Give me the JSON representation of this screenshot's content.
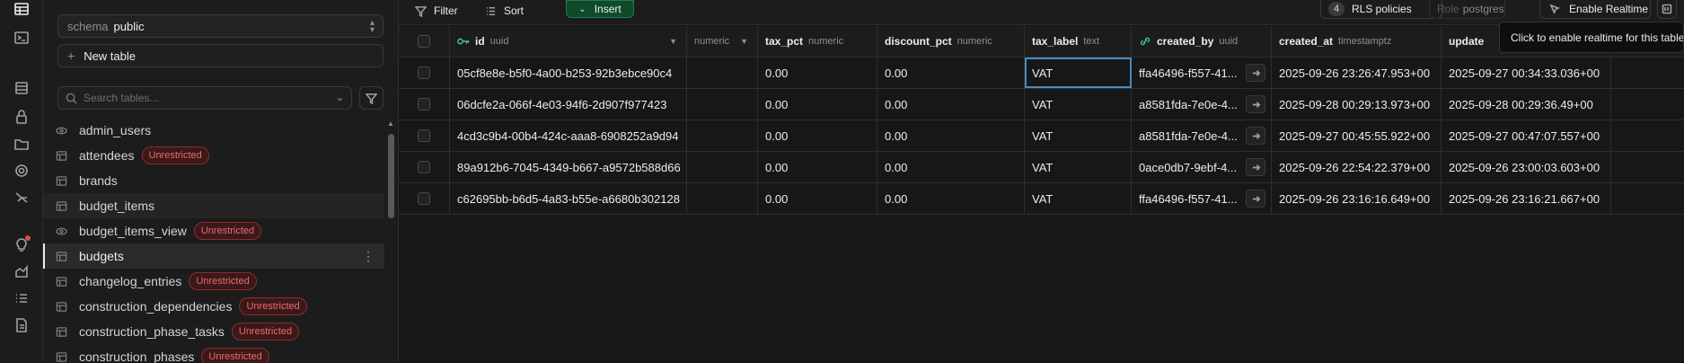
{
  "sidebar": {
    "schema_label": "schema",
    "schema_value": "public",
    "new_table_label": "New table",
    "search_placeholder": "Search tables...",
    "tables": [
      {
        "name": "admin_users",
        "badge": "",
        "icon": "view-icon"
      },
      {
        "name": "attendees",
        "badge": "Unrestricted",
        "icon": "table-icon"
      },
      {
        "name": "brands",
        "badge": "",
        "icon": "table-icon"
      },
      {
        "name": "budget_items",
        "badge": "",
        "icon": "table-icon"
      },
      {
        "name": "budget_items_view",
        "badge": "Unrestricted",
        "icon": "view-icon"
      },
      {
        "name": "budgets",
        "badge": "",
        "icon": "table-icon"
      },
      {
        "name": "changelog_entries",
        "badge": "Unrestricted",
        "icon": "table-icon"
      },
      {
        "name": "construction_dependencies",
        "badge": "Unrestricted",
        "icon": "table-icon"
      },
      {
        "name": "construction_phase_tasks",
        "badge": "Unrestricted",
        "icon": "table-icon"
      },
      {
        "name": "construction_phases",
        "badge": "Unrestricted",
        "icon": "table-icon"
      }
    ]
  },
  "toolbar": {
    "filter_label": "Filter",
    "sort_label": "Sort",
    "insert_label": "Insert",
    "rls_count": "4",
    "rls_label": "RLS policies",
    "role_label": "Role",
    "role_value": "postgres",
    "realtime_label": "Enable Realtime",
    "tooltip": "Click to enable realtime for this table"
  },
  "grid": {
    "columns": [
      {
        "name": "",
        "type": "numeric"
      },
      {
        "name": "id",
        "type": "uuid"
      },
      {
        "name": "",
        "type": "numeric"
      },
      {
        "name": "tax_pct",
        "type": "numeric"
      },
      {
        "name": "discount_pct",
        "type": "numeric"
      },
      {
        "name": "tax_label",
        "type": "text"
      },
      {
        "name": "created_by",
        "type": "uuid"
      },
      {
        "name": "created_at",
        "type": "timestamptz"
      },
      {
        "name": "update",
        "type": ""
      }
    ],
    "rows": [
      {
        "id": "05cf8e8e-b5f0-4a00-b253-92b3ebce90c4",
        "tax_pct": "0.00",
        "discount_pct": "0.00",
        "tax_label": "VAT",
        "created_by": "ffa46496-f557-41...",
        "created_at": "2025-09-26 23:26:47.953+00",
        "updated_at": "2025-09-27 00:34:33.036+00"
      },
      {
        "id": "06dcfe2a-066f-4e03-94f6-2d907f977423",
        "tax_pct": "0.00",
        "discount_pct": "0.00",
        "tax_label": "VAT",
        "created_by": "a8581fda-7e0e-4...",
        "created_at": "2025-09-28 00:29:13.973+00",
        "updated_at": "2025-09-28 00:29:36.49+00"
      },
      {
        "id": "4cd3c9b4-00b4-424c-aaa8-6908252a9d94",
        "tax_pct": "0.00",
        "discount_pct": "0.00",
        "tax_label": "VAT",
        "created_by": "a8581fda-7e0e-4...",
        "created_at": "2025-09-27 00:45:55.922+00",
        "updated_at": "2025-09-27 00:47:07.557+00"
      },
      {
        "id": "89a912b6-7045-4349-b667-a9572b588d66",
        "tax_pct": "0.00",
        "discount_pct": "0.00",
        "tax_label": "VAT",
        "created_by": "0ace0db7-9ebf-4...",
        "created_at": "2025-09-26 22:54:22.379+00",
        "updated_at": "2025-09-26 23:00:03.603+00"
      },
      {
        "id": "c62695bb-b6d5-4a83-b55e-a6680b302128",
        "tax_pct": "0.00",
        "discount_pct": "0.00",
        "tax_label": "VAT",
        "created_by": "ffa46496-f557-41...",
        "created_at": "2025-09-26 23:16:16.649+00",
        "updated_at": "2025-09-26 23:16:21.667+00"
      }
    ]
  }
}
